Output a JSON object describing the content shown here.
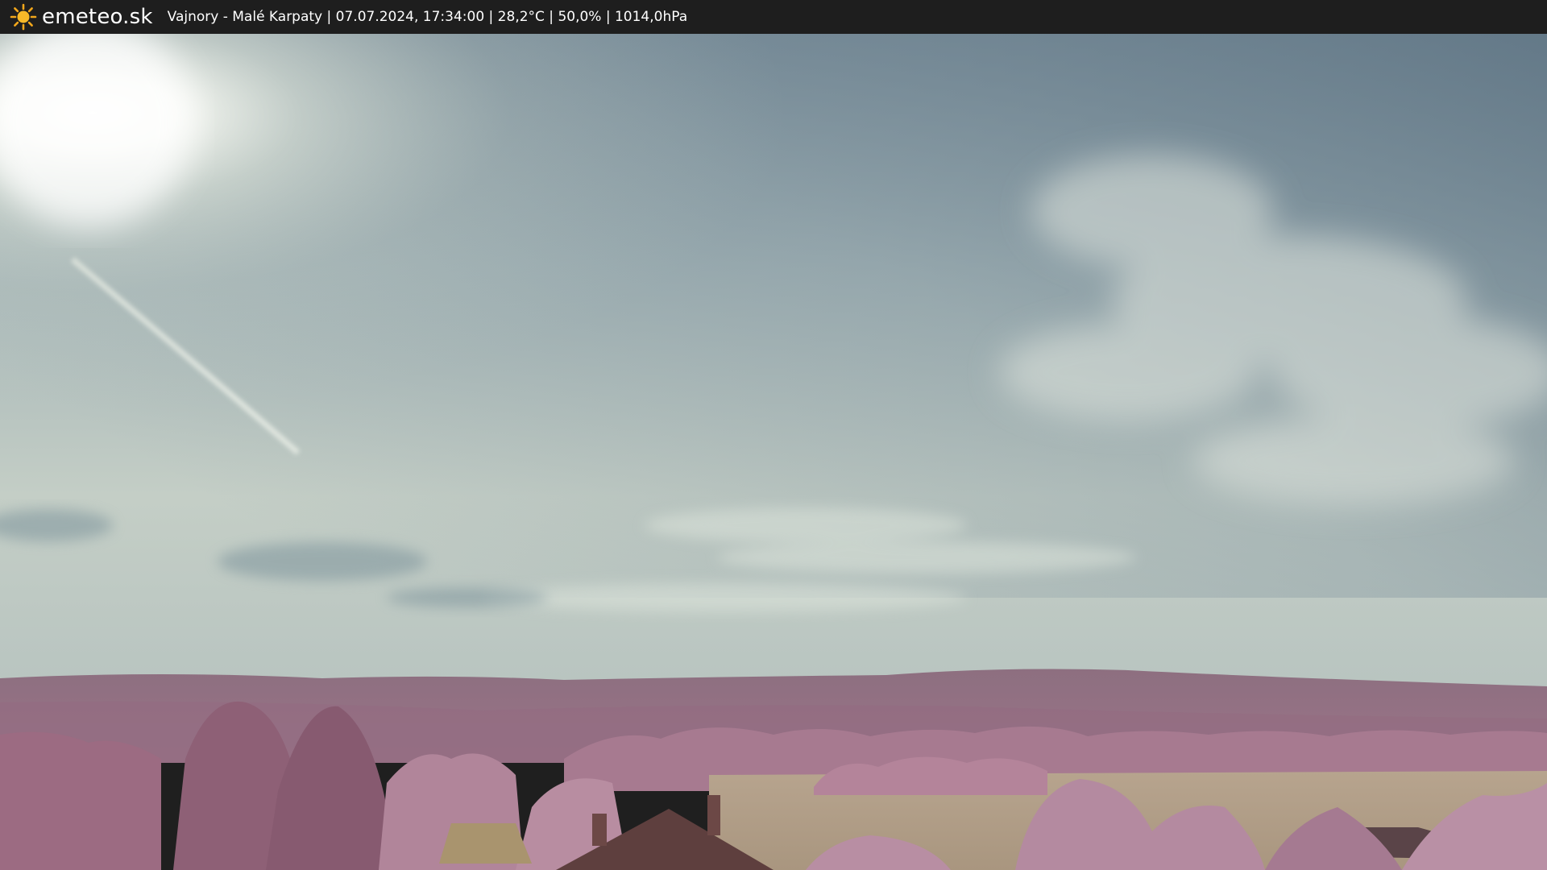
{
  "header": {
    "brand": "emeteo.sk",
    "caption": "Vajnory - Malé Karpaty | 07.07.2024, 17:34:00 | 28,2°C | 50,0% | 1014,0hPa",
    "logo_icon": "sun-icon"
  },
  "scene": {
    "description_icon": "webcam-landscape",
    "colors": {
      "sky_top": "#6f8594",
      "sky_mid": "#b9c6c3",
      "sky_horizon": "#c9d1c6",
      "foliage": "#a7798f",
      "hills": "#8f6a7c",
      "field": "#b9a58f",
      "roof": "#5e3f3e"
    }
  }
}
